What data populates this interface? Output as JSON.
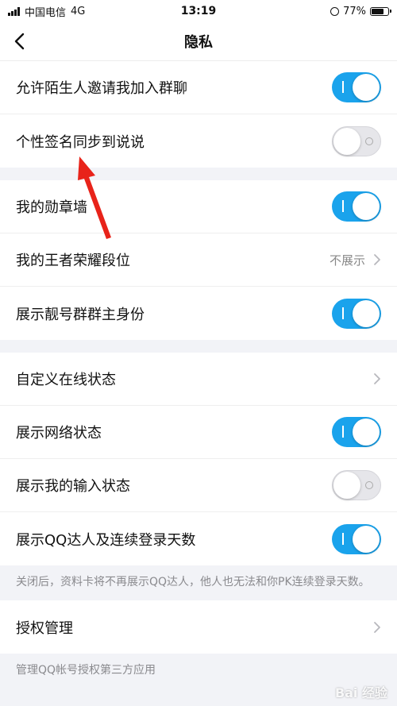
{
  "status_bar": {
    "carrier": "中国电信",
    "network": "4G",
    "time": "13:19",
    "battery": "77%",
    "battery_level": 0.77
  },
  "nav": {
    "title": "隐私",
    "back_icon": "chevron-left-icon"
  },
  "groups": [
    {
      "rows": [
        {
          "label": "允许陌生人邀请我加入群聊",
          "toggle": true
        },
        {
          "label": "个性签名同步到说说",
          "toggle": false
        }
      ]
    },
    {
      "rows": [
        {
          "label": "我的勋章墙",
          "toggle": true
        },
        {
          "label": "我的王者荣耀段位",
          "value": "不展示"
        },
        {
          "label": "展示靓号群群主身份",
          "toggle": true
        }
      ]
    },
    {
      "rows": [
        {
          "label": "自定义在线状态"
        },
        {
          "label": "展示网络状态",
          "toggle": true
        },
        {
          "label": "展示我的输入状态",
          "toggle": false
        },
        {
          "label": "展示QQ达人及连续登录天数",
          "toggle": true
        }
      ],
      "note": "关闭后，资料卡将不再展示QQ达人，他人也无法和你PK连续登录天数。"
    },
    {
      "rows": [
        {
          "label": "授权管理"
        }
      ],
      "note": "管理QQ帐号授权第三方应用"
    }
  ],
  "colors": {
    "toggle_on": "#1aa3ec",
    "annotation_arrow": "#e8231a"
  },
  "watermark": "Bai 经验"
}
